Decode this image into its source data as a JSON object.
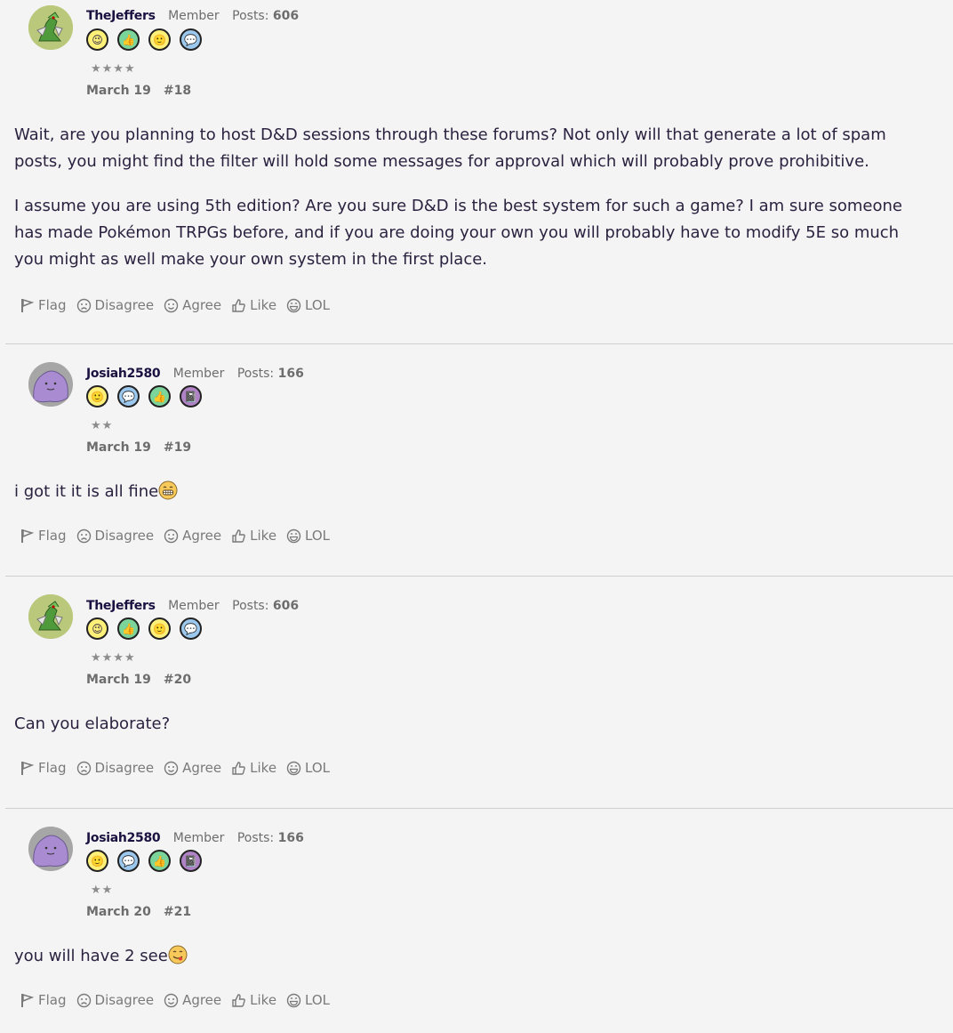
{
  "posts": [
    {
      "username": "TheJeffers",
      "role": "Member",
      "posts_label": "Posts:",
      "posts_count": "606",
      "stars": "★★★★",
      "date": "March 19",
      "number": "#18",
      "paragraphs": [
        "Wait, are you planning to host D&D sessions through these forums? Not only will that generate a lot of spam posts, you might find the filter will hold some messages for approval which will probably prove prohibitive.",
        "I assume you are using 5th edition? Are you sure D&D is the best system for such a game? I am sure someone has made Pokémon TRPGs before, and if you are doing your own you will probably have to modify 5E so much you might as well make your own system in the first place."
      ]
    },
    {
      "username": "Josiah2580",
      "role": "Member",
      "posts_label": "Posts:",
      "posts_count": "166",
      "stars": "★★",
      "date": "March 19",
      "number": "#19",
      "paragraphs": [
        "i got it it is all fine"
      ]
    },
    {
      "username": "TheJeffers",
      "role": "Member",
      "posts_label": "Posts:",
      "posts_count": "606",
      "stars": "★★★★",
      "date": "March 19",
      "number": "#20",
      "paragraphs": [
        "Can you elaborate?"
      ]
    },
    {
      "username": "Josiah2580",
      "role": "Member",
      "posts_label": "Posts:",
      "posts_count": "166",
      "stars": "★★",
      "date": "March 20",
      "number": "#21",
      "paragraphs": [
        "you will have 2 see"
      ]
    }
  ],
  "reactions": {
    "flag": "Flag",
    "disagree": "Disagree",
    "agree": "Agree",
    "like": "Like",
    "lol": "LOL"
  },
  "colors": {
    "background": "#f4f4f4",
    "text": "#2b2240",
    "muted": "#6d6d6d"
  }
}
